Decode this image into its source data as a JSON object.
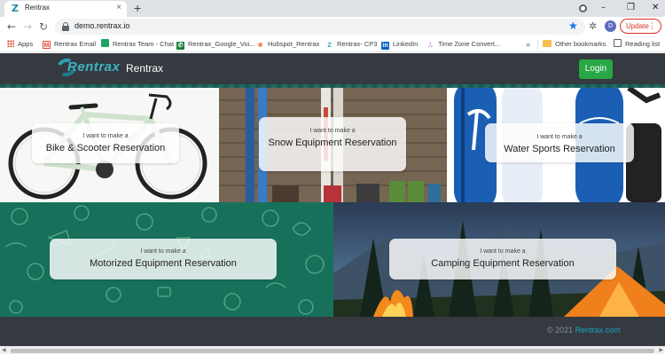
{
  "browser": {
    "tab": {
      "title": "Rentrax",
      "close": "×"
    },
    "new_tab": "+",
    "window_controls": {
      "minimize": "–",
      "maximize": "❐",
      "close": "✕"
    },
    "nav": {
      "back": "←",
      "forward": "→",
      "reload": "↻"
    },
    "url": "demo.rentrax.io",
    "profile_initial": "D",
    "update_label": "Update",
    "menu": "⋮"
  },
  "bookmarks": {
    "items": [
      {
        "label": "Apps",
        "icon": "apps-grid-icon"
      },
      {
        "label": "Rentrax Email",
        "icon": "gmail-icon",
        "color": "#ea4335"
      },
      {
        "label": "Rentrax Team - Chat",
        "icon": "google-chat-icon",
        "color": "#1ea362"
      },
      {
        "label": "Rentrax_Google_Voi...",
        "icon": "google-voice-icon",
        "color": "#188038"
      },
      {
        "label": "Hubspot_Rentrax",
        "icon": "hubspot-icon",
        "color": "#ff7a59"
      },
      {
        "label": "Rentrax- CP3",
        "icon": "rentrax-icon",
        "color": "#2a9fb0"
      },
      {
        "label": "LinkedIn",
        "icon": "linkedin-icon",
        "color": "#0a66c2"
      },
      {
        "label": "Time Zone Convert...",
        "icon": "timezone-icon",
        "color": "#9c27b0"
      }
    ],
    "more": "»",
    "other_bookmarks": "Other bookmarks",
    "reading_list": "Reading list"
  },
  "site": {
    "logo_text": "Rentrax",
    "brand": "Rentrax",
    "login": "Login"
  },
  "tiles": [
    {
      "sub": "I want to make a",
      "title": "Bike & Scooter Reservation"
    },
    {
      "sub": "I want to make a",
      "title": "Snow Equipment Reservation"
    },
    {
      "sub": "I want to make a",
      "title": "Water Sports Reservation"
    },
    {
      "sub": "I want to make a",
      "title": "Motorized Equipment Reservation"
    },
    {
      "sub": "I want to make a",
      "title": "Camping Equipment Reservation"
    }
  ],
  "footer": {
    "copyright": "© 2021",
    "link": "Rentrax.com"
  },
  "colors": {
    "header": "#343a40",
    "login_green": "#28a745",
    "brand_teal": "#2a9fb0",
    "update_red": "#d93025"
  }
}
